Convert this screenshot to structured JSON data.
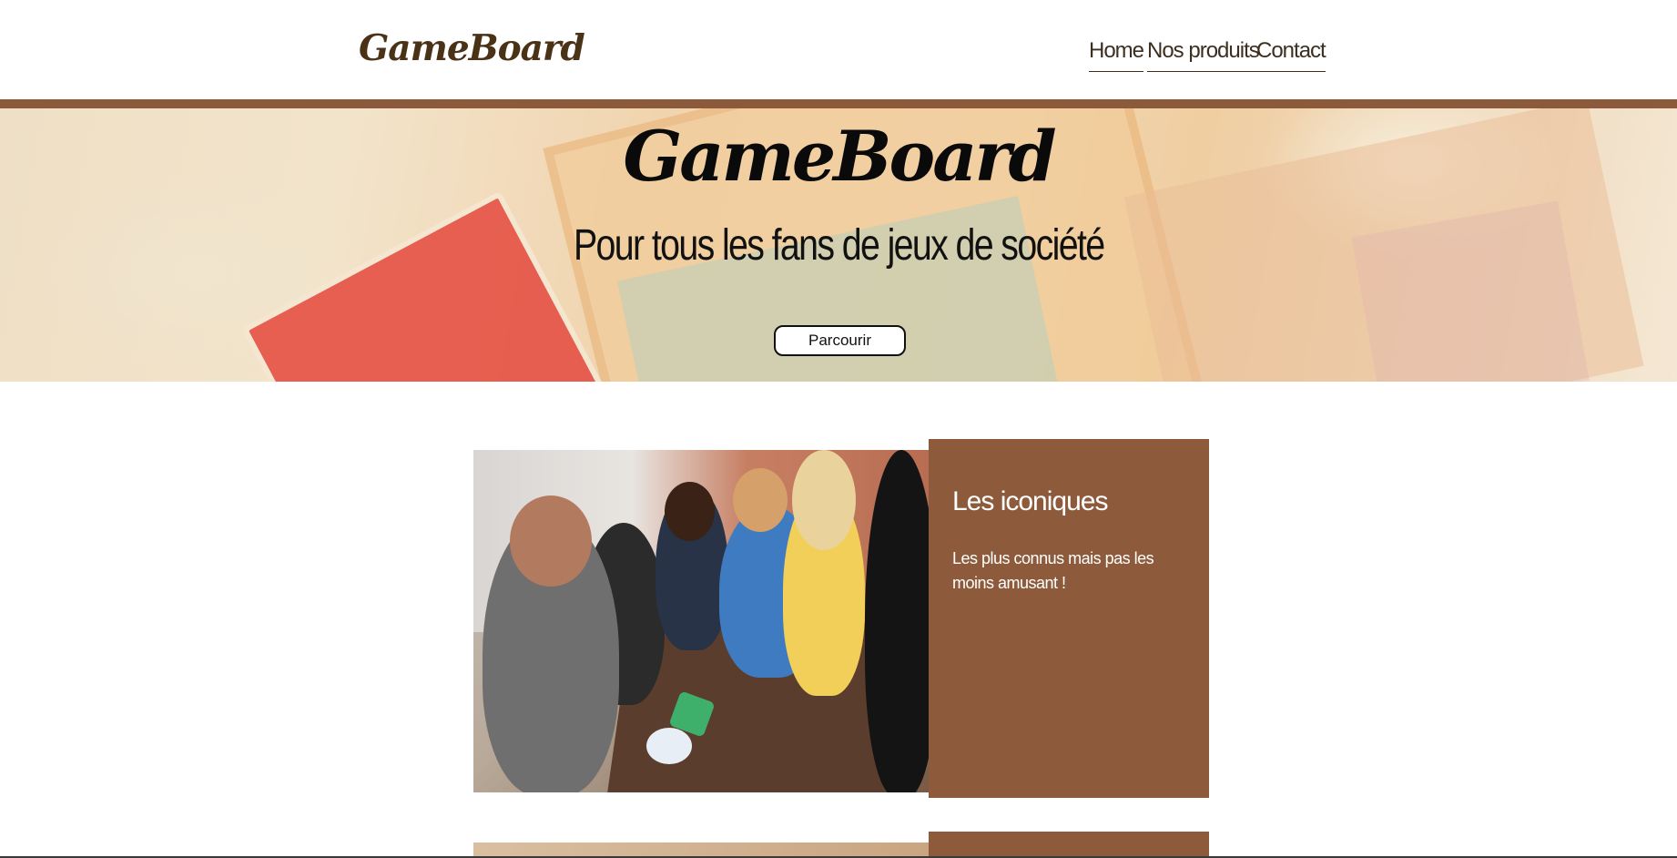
{
  "header": {
    "logo": "GameBoard",
    "nav": {
      "home": "Home",
      "products": "Nos produits",
      "contact": "Contact"
    }
  },
  "hero": {
    "title": "GameBoard",
    "subtitle": "Pour tous les fans de jeux de société",
    "button": "Parcourir"
  },
  "products": [
    {
      "title": "Les iconiques",
      "description": "Les plus connus mais pas les moins amusant !"
    }
  ],
  "colors": {
    "accent": "#8d5b3b",
    "logo": "#4a3217"
  }
}
